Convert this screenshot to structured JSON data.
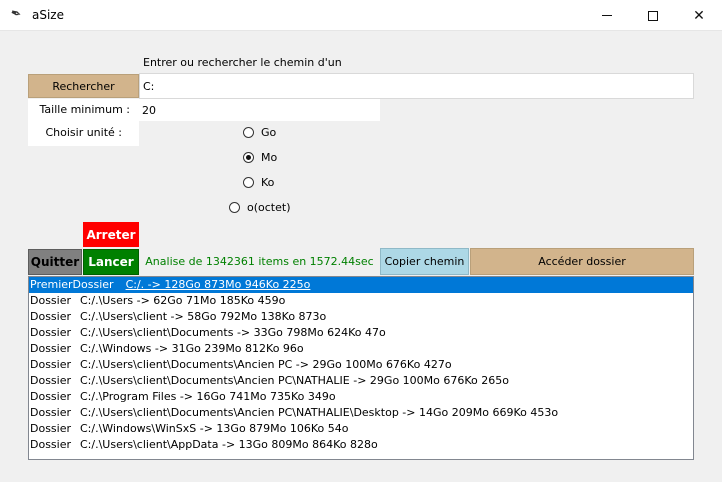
{
  "window": {
    "title": "aSize",
    "minimize_glyph": "",
    "maximize_glyph": "",
    "close_glyph": "✕"
  },
  "search": {
    "prompt_label": "Entrer ou rechercher le chemin d'un dossier :",
    "button_label": "Rechercher",
    "path_value": "C:"
  },
  "size": {
    "label": "Taille minimum :",
    "value": "20"
  },
  "unit": {
    "label": "Choisir unité :",
    "options": [
      "Go",
      "Mo",
      "Ko",
      "o(octet)"
    ],
    "selected": "Mo"
  },
  "actions": {
    "stop_label": "Arreter",
    "quit_label": "Quitter",
    "run_label": "Lancer",
    "status": "Analise de 1342361 items en 1572.44sec",
    "copy_label": "Copier chemin",
    "access_label": "Accéder dossier"
  },
  "results": [
    {
      "type": "PremierDossier",
      "entry": "C:/. -> 128Go 873Mo 946Ko 225o",
      "selected": true
    },
    {
      "type": "Dossier",
      "entry": "C:/.\\Users -> 62Go 71Mo 185Ko 459o"
    },
    {
      "type": "Dossier",
      "entry": "C:/.\\Users\\client -> 58Go 792Mo 138Ko 873o"
    },
    {
      "type": "Dossier",
      "entry": "C:/.\\Users\\client\\Documents -> 33Go 798Mo 624Ko 47o"
    },
    {
      "type": "Dossier",
      "entry": "C:/.\\Windows -> 31Go 239Mo 812Ko 96o"
    },
    {
      "type": "Dossier",
      "entry": "C:/.\\Users\\client\\Documents\\Ancien PC -> 29Go 100Mo 676Ko 427o"
    },
    {
      "type": "Dossier",
      "entry": "C:/.\\Users\\client\\Documents\\Ancien PC\\NATHALIE -> 29Go 100Mo 676Ko 265o"
    },
    {
      "type": "Dossier",
      "entry": "C:/.\\Program Files -> 16Go 741Mo 735Ko 349o"
    },
    {
      "type": "Dossier",
      "entry": "C:/.\\Users\\client\\Documents\\Ancien PC\\NATHALIE\\Desktop -> 14Go 209Mo 669Ko 453o"
    },
    {
      "type": "Dossier",
      "entry": "C:/.\\Windows\\WinSxS -> 13Go 879Mo 106Ko 54o"
    },
    {
      "type": "Dossier",
      "entry": "C:/.\\Users\\client\\AppData -> 13Go 809Mo 864Ko 828o"
    }
  ]
}
